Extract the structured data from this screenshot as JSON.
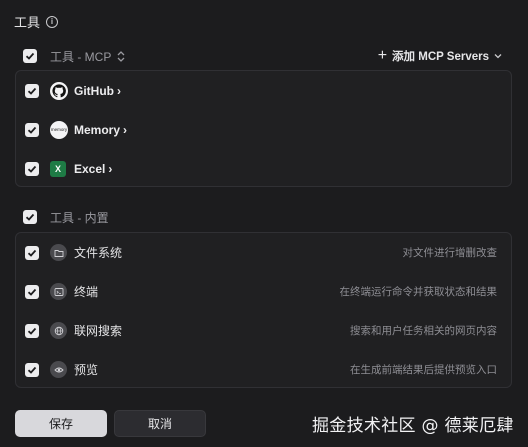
{
  "header": {
    "title": "工具"
  },
  "mcp_section": {
    "label": "工具 - MCP",
    "add_label": "添加 MCP Servers",
    "items": [
      {
        "name": "GitHub",
        "icon": "github-icon"
      },
      {
        "name": "Memory",
        "icon": "memory-icon",
        "icon_text": "memory"
      },
      {
        "name": "Excel",
        "icon": "excel-icon",
        "icon_text": "X"
      }
    ]
  },
  "builtin_section": {
    "label": "工具 - 内置",
    "items": [
      {
        "name": "文件系统",
        "desc": "对文件进行增删改查",
        "icon": "folder-icon"
      },
      {
        "name": "终端",
        "desc": "在终端运行命令并获取状态和结果",
        "icon": "terminal-icon"
      },
      {
        "name": "联网搜索",
        "desc": "搜索和用户任务相关的网页内容",
        "icon": "globe-icon"
      },
      {
        "name": "预览",
        "desc": "在生成前端结果后提供预览入口",
        "icon": "eye-icon"
      }
    ]
  },
  "footer": {
    "save_label": "保存",
    "cancel_label": "取消"
  },
  "watermark": "掘金技术社区 @ 德莱厄肆",
  "colors": {
    "background": "#1c1c1e",
    "panel": "#202022",
    "excel_green": "#1e7b45"
  }
}
